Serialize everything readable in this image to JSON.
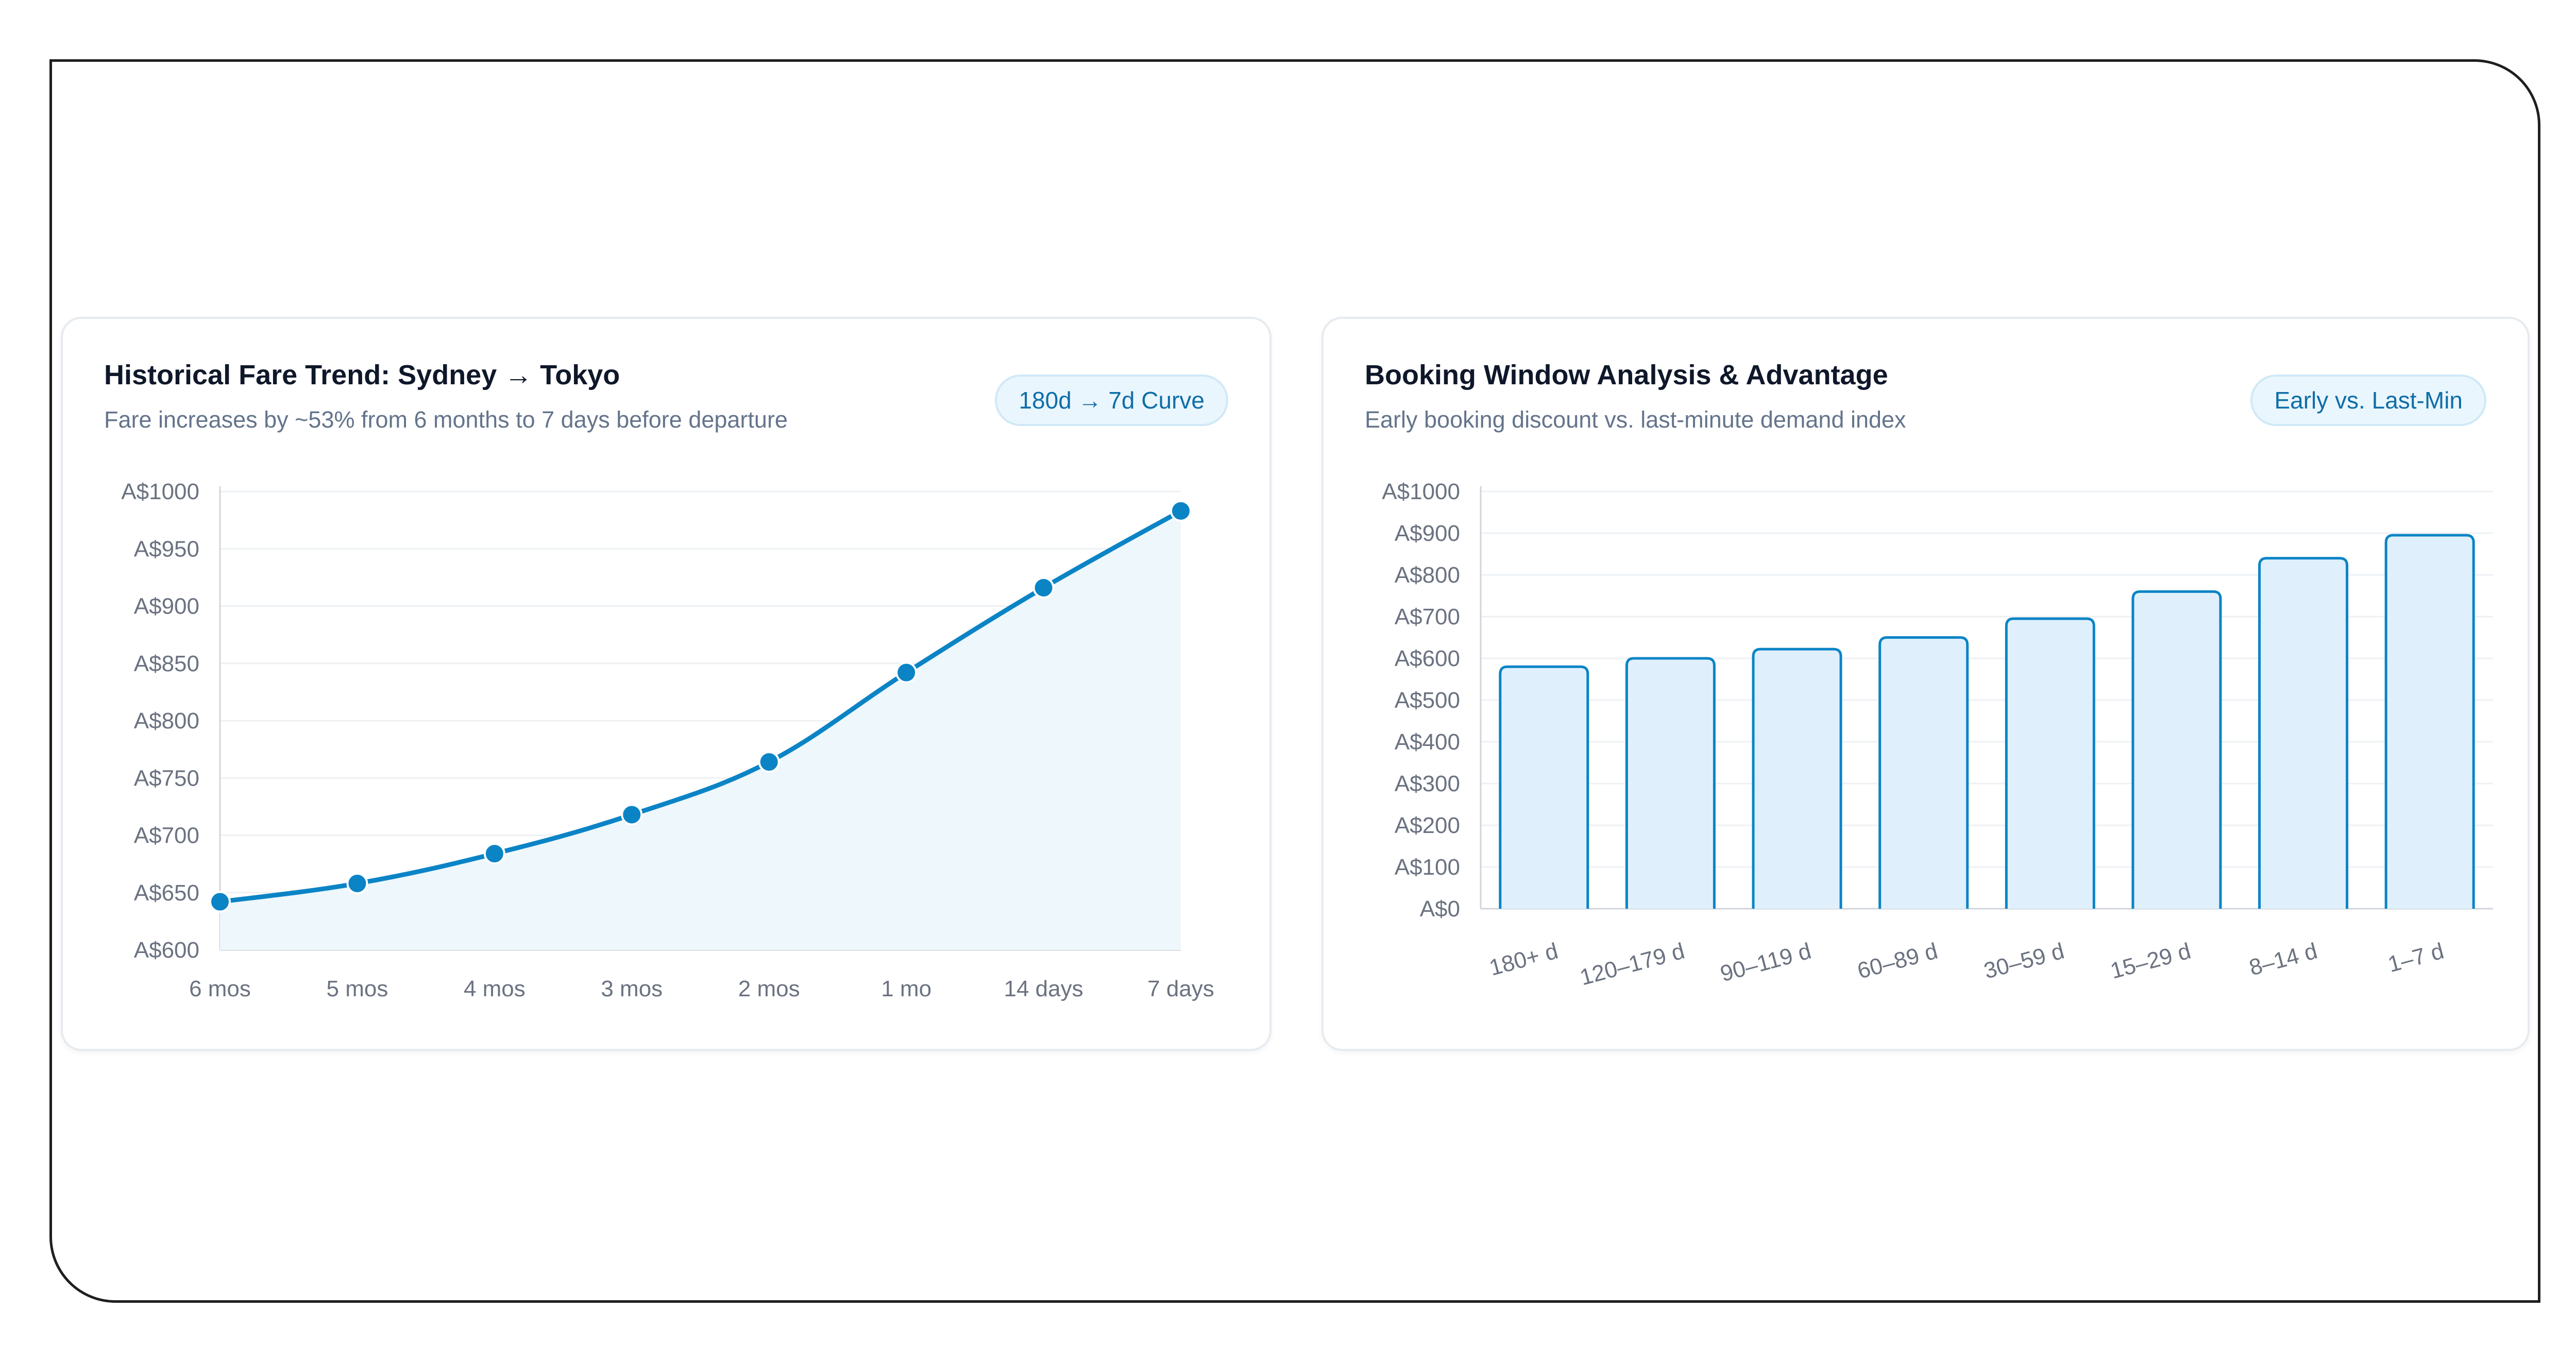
{
  "left_card": {
    "title": "Historical Fare Trend: Sydney → Tokyo",
    "subtitle": "Fare increases by ~53% from 6 months to 7 days before departure",
    "badge": "180d → 7d Curve"
  },
  "right_card": {
    "title": "Booking Window Analysis & Advantage",
    "subtitle": "Early booking discount vs. last-minute demand index",
    "badge": "Early vs. Last-Min"
  },
  "colors": {
    "line": "#0b84c6",
    "area_fill": "#eef7fb",
    "bar_fill": "#dff0fc",
    "bar_stroke": "#0b84c6",
    "grid": "#eef1f4",
    "axis": "#d1d5db"
  },
  "chart_data": [
    {
      "type": "area",
      "categories": [
        "6 mos",
        "5 mos",
        "4 mos",
        "3 mos",
        "2 mos",
        "1 mo",
        "14 days",
        "7 days"
      ],
      "values": [
        642,
        658,
        684,
        718,
        764,
        842,
        916,
        983
      ],
      "ylim": [
        600,
        1000
      ],
      "yticks": [
        {
          "v": 600,
          "label": "A$600"
        },
        {
          "v": 650,
          "label": "A$650"
        },
        {
          "v": 700,
          "label": "A$700"
        },
        {
          "v": 750,
          "label": "A$750"
        },
        {
          "v": 800,
          "label": "A$800"
        },
        {
          "v": 850,
          "label": "A$850"
        },
        {
          "v": 900,
          "label": "A$900"
        },
        {
          "v": 950,
          "label": "A$950"
        },
        {
          "v": 1000,
          "label": "A$1000"
        }
      ],
      "grid": true,
      "legend": "none"
    },
    {
      "type": "bar",
      "categories": [
        "180+ d",
        "120–179 d",
        "90–119 d",
        "60–89 d",
        "30–59 d",
        "15–29 d",
        "8–14 d",
        "1–7 d"
      ],
      "values": [
        580,
        600,
        622,
        650,
        695,
        760,
        840,
        895
      ],
      "ylim": [
        0,
        1000
      ],
      "yticks": [
        {
          "v": 0,
          "label": "A$0"
        },
        {
          "v": 100,
          "label": "A$100"
        },
        {
          "v": 200,
          "label": "A$200"
        },
        {
          "v": 300,
          "label": "A$300"
        },
        {
          "v": 400,
          "label": "A$400"
        },
        {
          "v": 500,
          "label": "A$500"
        },
        {
          "v": 600,
          "label": "A$600"
        },
        {
          "v": 700,
          "label": "A$700"
        },
        {
          "v": 800,
          "label": "A$800"
        },
        {
          "v": 900,
          "label": "A$900"
        },
        {
          "v": 1000,
          "label": "A$1000"
        }
      ],
      "grid": true,
      "legend": "none"
    }
  ]
}
